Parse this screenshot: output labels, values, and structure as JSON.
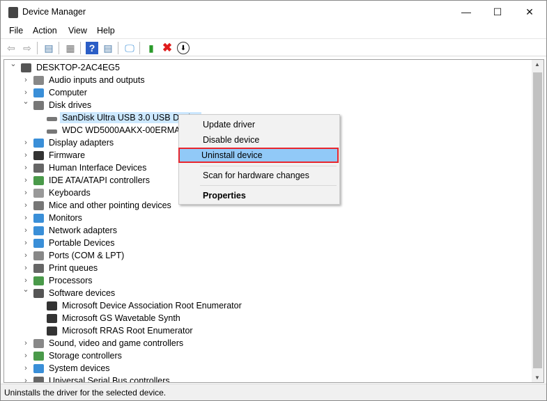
{
  "window": {
    "title": "Device Manager",
    "minimize": "—",
    "maximize": "☐",
    "close": "✕"
  },
  "menu": [
    "File",
    "Action",
    "View",
    "Help"
  ],
  "toolbar": [
    "back-icon",
    "forward-icon",
    "show-hide-console-tree-icon",
    "properties-icon",
    "help-icon",
    "action-pane-icon",
    "scan-hardware-icon",
    "update-driver-icon",
    "uninstall-icon",
    "disable-icon"
  ],
  "tree": [
    {
      "label": "DESKTOP-2AC4EG5",
      "level": 0,
      "exp": "open",
      "icon": "#555"
    },
    {
      "label": "Audio inputs and outputs",
      "level": 1,
      "exp": "closed",
      "icon": "#888"
    },
    {
      "label": "Computer",
      "level": 1,
      "exp": "closed",
      "icon": "#3a8fd8"
    },
    {
      "label": "Disk drives",
      "level": 1,
      "exp": "open",
      "icon": "#777"
    },
    {
      "label": "SanDisk Ultra USB 3.0 USB Device",
      "level": 2,
      "exp": "",
      "icon": "#777",
      "selected": true
    },
    {
      "label": "WDC WD5000AAKX-00ERMA0",
      "level": 2,
      "exp": "",
      "icon": "#777"
    },
    {
      "label": "Display adapters",
      "level": 1,
      "exp": "closed",
      "icon": "#3a8fd8"
    },
    {
      "label": "Firmware",
      "level": 1,
      "exp": "closed",
      "icon": "#333"
    },
    {
      "label": "Human Interface Devices",
      "level": 1,
      "exp": "closed",
      "icon": "#666"
    },
    {
      "label": "IDE ATA/ATAPI controllers",
      "level": 1,
      "exp": "closed",
      "icon": "#4a9a4a"
    },
    {
      "label": "Keyboards",
      "level": 1,
      "exp": "closed",
      "icon": "#999"
    },
    {
      "label": "Mice and other pointing devices",
      "level": 1,
      "exp": "closed",
      "icon": "#777"
    },
    {
      "label": "Monitors",
      "level": 1,
      "exp": "closed",
      "icon": "#3a8fd8"
    },
    {
      "label": "Network adapters",
      "level": 1,
      "exp": "closed",
      "icon": "#3a8fd8"
    },
    {
      "label": "Portable Devices",
      "level": 1,
      "exp": "closed",
      "icon": "#3a8fd8"
    },
    {
      "label": "Ports (COM & LPT)",
      "level": 1,
      "exp": "closed",
      "icon": "#888"
    },
    {
      "label": "Print queues",
      "level": 1,
      "exp": "closed",
      "icon": "#666"
    },
    {
      "label": "Processors",
      "level": 1,
      "exp": "closed",
      "icon": "#4a9a4a"
    },
    {
      "label": "Software devices",
      "level": 1,
      "exp": "open",
      "icon": "#555"
    },
    {
      "label": "Microsoft Device Association Root Enumerator",
      "level": 2,
      "exp": "",
      "icon": "#333"
    },
    {
      "label": "Microsoft GS Wavetable Synth",
      "level": 2,
      "exp": "",
      "icon": "#333"
    },
    {
      "label": "Microsoft RRAS Root Enumerator",
      "level": 2,
      "exp": "",
      "icon": "#333"
    },
    {
      "label": "Sound, video and game controllers",
      "level": 1,
      "exp": "closed",
      "icon": "#888"
    },
    {
      "label": "Storage controllers",
      "level": 1,
      "exp": "closed",
      "icon": "#4a9a4a"
    },
    {
      "label": "System devices",
      "level": 1,
      "exp": "closed",
      "icon": "#3a8fd8"
    },
    {
      "label": "Universal Serial Bus controllers",
      "level": 1,
      "exp": "closed",
      "icon": "#666"
    }
  ],
  "context_menu": {
    "update": "Update driver",
    "disable": "Disable device",
    "uninstall": "Uninstall device",
    "scan": "Scan for hardware changes",
    "properties": "Properties"
  },
  "status": "Uninstalls the driver for the selected device."
}
